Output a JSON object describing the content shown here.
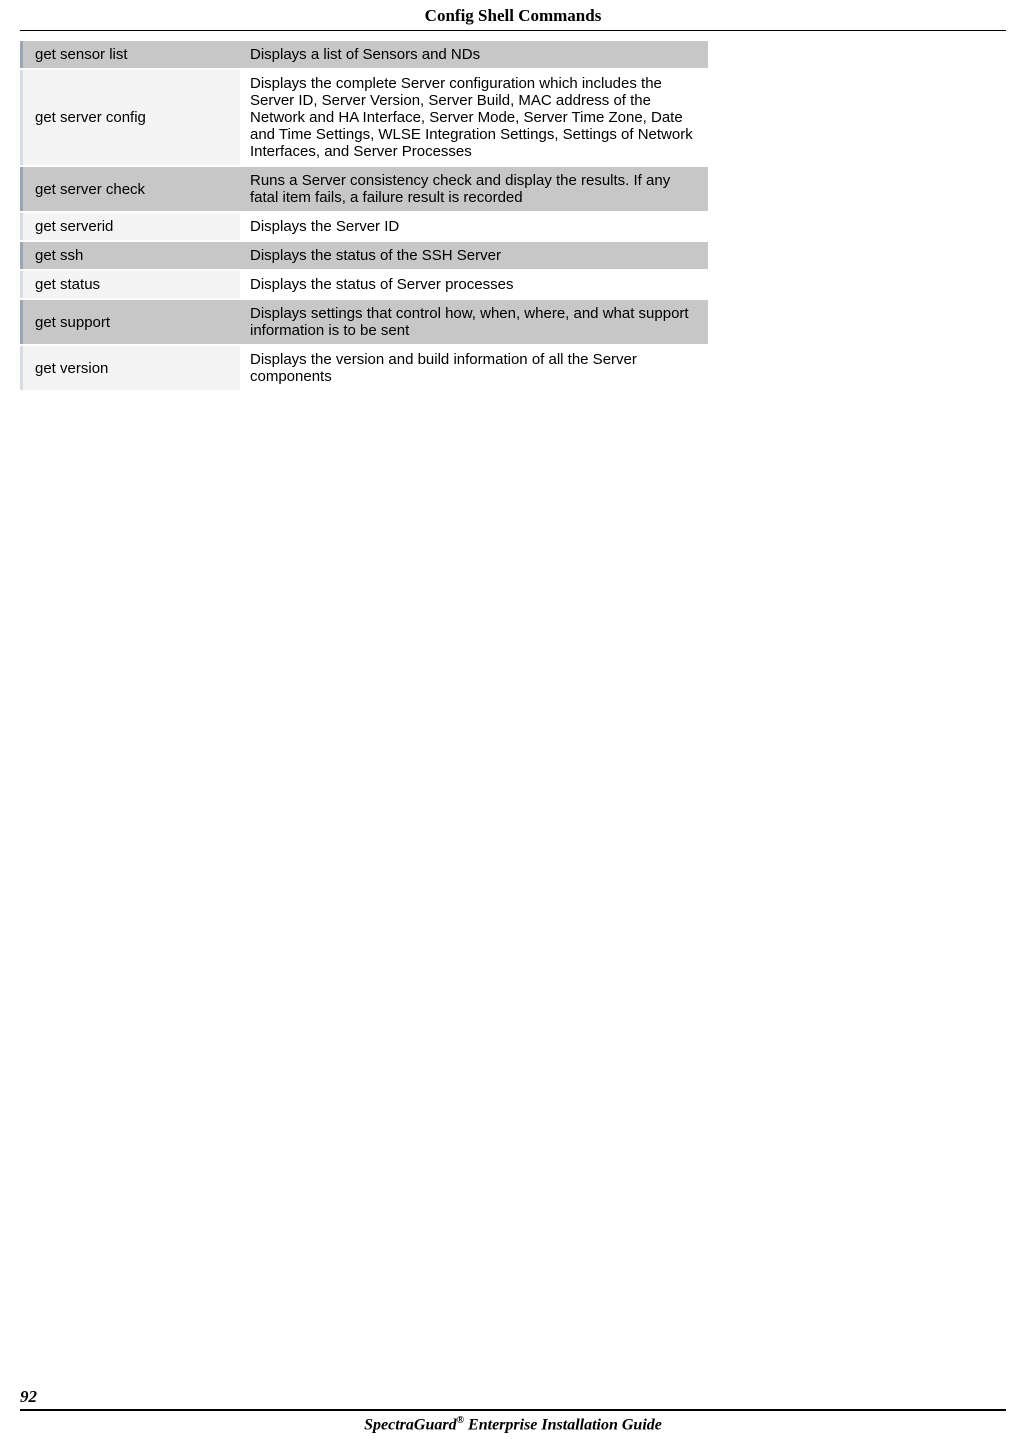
{
  "header": {
    "title": "Config Shell Commands"
  },
  "commands": [
    {
      "cmd": "get sensor list",
      "desc": "Displays a list of Sensors and NDs",
      "shaded": true
    },
    {
      "cmd": "get server config",
      "desc": "Displays the complete Server configuration which includes the Server ID, Server Version, Server Build, MAC address of the Network and HA Interface, Server Mode, Server Time Zone, Date and Time Settings, WLSE Integration Settings, Settings of Network Interfaces, and Server Processes",
      "shaded": false
    },
    {
      "cmd": "get server check",
      "desc": "Runs a Server consistency check and display the results. If any fatal item fails, a failure result is recorded",
      "shaded": true
    },
    {
      "cmd": "get serverid",
      "desc": "Displays the Server ID",
      "shaded": false
    },
    {
      "cmd": "get ssh",
      "desc": "Displays the status of the SSH Server",
      "shaded": true
    },
    {
      "cmd": "get status",
      "desc": "Displays the status of Server processes",
      "shaded": false
    },
    {
      "cmd": "get support",
      "desc": "Displays settings that control how, when, where, and what support information is to be sent",
      "shaded": true
    },
    {
      "cmd": "get version",
      "desc": "Displays the version and build information of all the Server components",
      "shaded": false
    }
  ],
  "footer": {
    "page_number": "92",
    "book_title_pre": "SpectraGuard",
    "book_title_sup": "®",
    "book_title_post": " Enterprise Installation Guide"
  }
}
